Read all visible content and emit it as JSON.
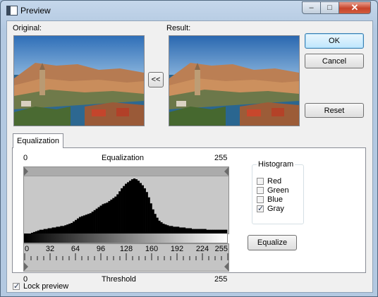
{
  "window": {
    "title": "Preview",
    "minimize": "–",
    "maximize": "□",
    "close": "✕"
  },
  "labels": {
    "original": "Original:",
    "result": "Result:"
  },
  "buttons": {
    "copy": "<<",
    "ok": "OK",
    "cancel": "Cancel",
    "reset": "Reset",
    "equalize": "Equalize"
  },
  "tabs": [
    {
      "label": "Equalization",
      "selected": true
    }
  ],
  "equalization": {
    "title": "Equalization",
    "min": "0",
    "max": "255",
    "threshold_label": "Threshold",
    "threshold_min": "0",
    "threshold_max": "255",
    "ticks": [
      "0",
      "32",
      "64",
      "96",
      "128",
      "160",
      "192",
      "224",
      "255"
    ],
    "range_low": 0,
    "range_high": 255
  },
  "histogram": {
    "title": "Histogram",
    "channels": [
      {
        "label": "Red",
        "checked": false
      },
      {
        "label": "Green",
        "checked": false
      },
      {
        "label": "Blue",
        "checked": false
      },
      {
        "label": "Gray",
        "checked": true
      }
    ],
    "values": [
      0,
      0,
      1,
      2,
      3,
      4,
      5,
      5,
      6,
      6,
      7,
      7,
      8,
      8,
      9,
      9,
      10,
      10,
      11,
      12,
      13,
      14,
      16,
      18,
      20,
      22,
      23,
      24,
      25,
      26,
      27,
      29,
      31,
      33,
      35,
      37,
      39,
      40,
      41,
      43,
      45,
      47,
      49,
      52,
      56,
      60,
      63,
      66,
      68,
      70,
      72,
      73,
      72,
      70,
      67,
      64,
      60,
      55,
      48,
      40,
      32,
      26,
      21,
      17,
      15,
      13,
      12,
      11,
      10,
      10,
      9,
      9,
      9,
      8,
      8,
      8,
      7,
      7,
      7,
      6,
      6,
      6,
      6,
      6,
      6,
      6,
      5,
      5,
      5,
      5,
      5,
      5,
      5,
      5,
      5,
      5
    ]
  },
  "lock_preview": {
    "label": "Lock preview",
    "checked": true
  }
}
